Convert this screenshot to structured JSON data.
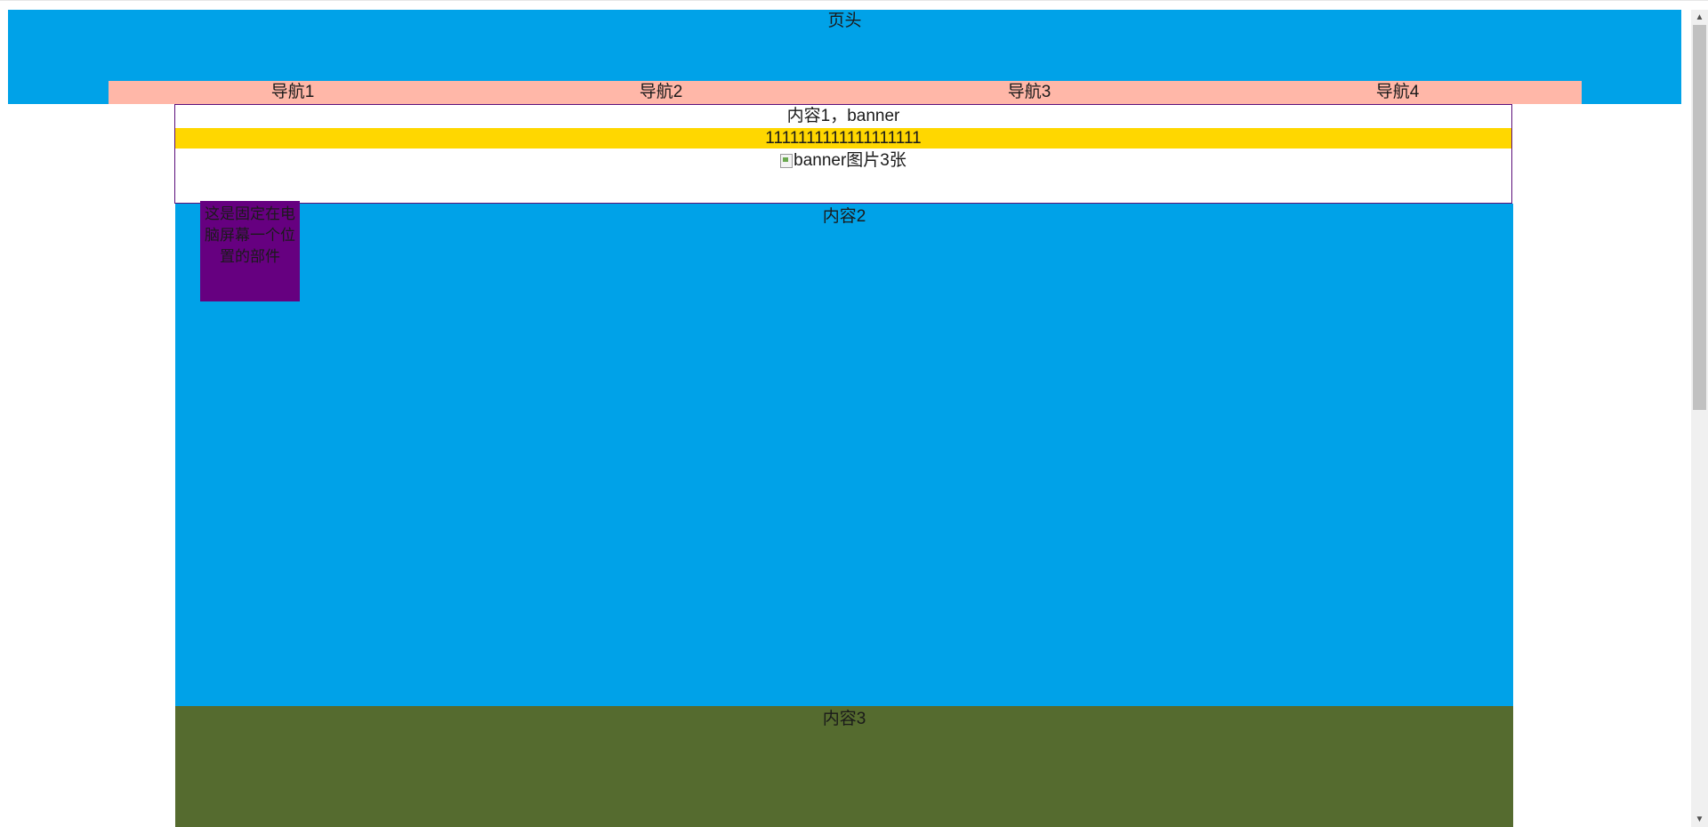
{
  "header": {
    "title": "页头"
  },
  "nav": {
    "items": [
      {
        "label": "导航1"
      },
      {
        "label": "导航2"
      },
      {
        "label": "导航3"
      },
      {
        "label": "导航4"
      }
    ]
  },
  "content1": {
    "label": "内容1，banner",
    "strip_text": "1111111111111111111",
    "banner_alt": "banner图片3张"
  },
  "content2": {
    "label": "内容2"
  },
  "content3": {
    "label": "内容3"
  },
  "fixed_widget": {
    "text": "这是固定在电脑屏幕一个位置的部件"
  },
  "colors": {
    "header_bg": "#00a2e8",
    "nav_bg": "#ffb7a8",
    "strip_bg": "#ffd700",
    "content2_bg": "#00a2e8",
    "content3_bg": "#556b2f",
    "fixed_widget_bg": "#660080"
  },
  "icons": {
    "broken_image": "broken-image-icon",
    "scroll_up": "arrow-up-icon",
    "scroll_down": "arrow-down-icon"
  }
}
